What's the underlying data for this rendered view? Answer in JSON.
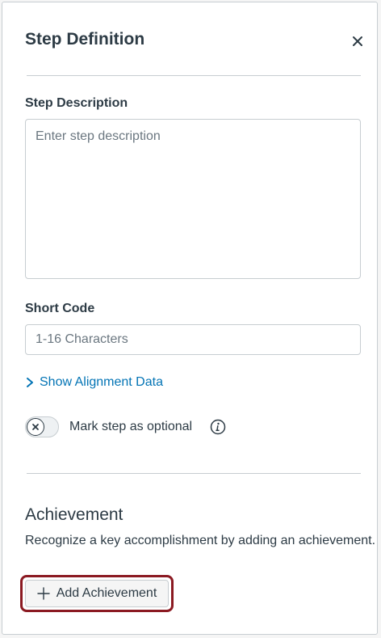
{
  "header": {
    "title": "Step Definition",
    "close_icon": "close-icon"
  },
  "step_description": {
    "label": "Step Description",
    "value": "",
    "placeholder": "Enter step description"
  },
  "short_code": {
    "label": "Short Code",
    "value": "",
    "placeholder": "1-16 Characters"
  },
  "alignment": {
    "label": "Show Alignment Data",
    "icon": "chevron-right-icon"
  },
  "optional": {
    "label": "Mark step as optional",
    "checked": false,
    "info_icon": "info-icon"
  },
  "achievement": {
    "title": "Achievement",
    "description": "Recognize a key accomplishment by adding an achievement.",
    "button_label": "Add Achievement",
    "button_icon": "plus-icon"
  },
  "colors": {
    "text": "#2d3b45",
    "link": "#0374b5",
    "border": "#c7cdd1",
    "focus_ring": "#8b1a22"
  }
}
